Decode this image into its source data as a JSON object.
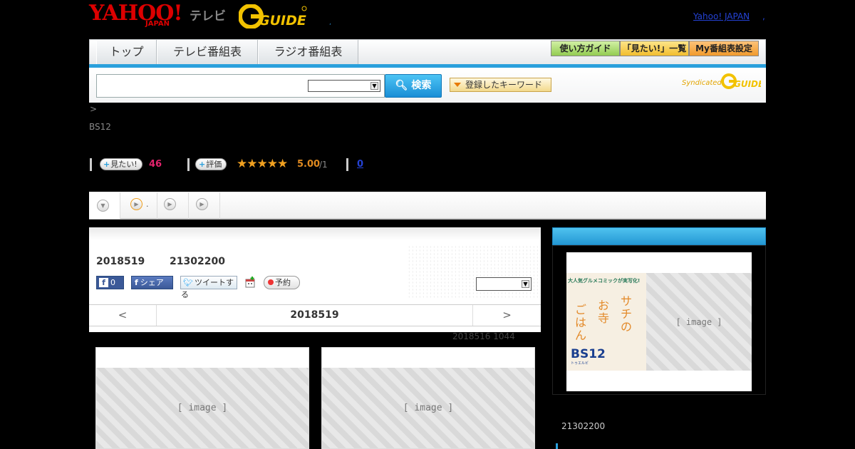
{
  "header": {
    "yahoo": "YAHOO!",
    "yahoo_sub": "JAPAN",
    "tv": "テレビ",
    "gguide_logo_text": "GUIDE",
    "dot": ",",
    "yahoo_japan_link": "Yahoo! JAPAN",
    "yahoo_japan_link_suffix": ","
  },
  "nav": {
    "tabs": [
      {
        "label": "トップ"
      },
      {
        "label": "テレビ番組表"
      },
      {
        "label": "ラジオ番組表"
      }
    ],
    "buttons": [
      {
        "label": "使い方ガイド",
        "color": "#a9d96a"
      },
      {
        "label": "「見たい!」一覧",
        "color": "#f6c93f"
      },
      {
        "label": "My番組表設定",
        "color": "#f6a23a"
      }
    ]
  },
  "search": {
    "placeholder": "",
    "select_value": "",
    "button_label": "検索",
    "keyword_button_label": "登録したキーワード",
    "syndicated": "Syndicated",
    "syndicated_logo": "GUIDE"
  },
  "breadcrumb": ">",
  "channel": "BS12",
  "stats": {
    "mitai_label": "見たい!",
    "mitai_count": "46",
    "hyoka_label": "評価",
    "stars": "★★★★★",
    "rating": "5.00",
    "rating_of": "/1",
    "review_count": "0"
  },
  "tabs": [
    {
      "label": ""
    },
    {
      "label": "."
    },
    {
      "label": ""
    },
    {
      "label": ""
    }
  ],
  "program": {
    "date": "2018519",
    "time": "21302200",
    "fb_like_count": "0",
    "fb_share": "シェア",
    "tweet": "ツイートする",
    "record": "予約",
    "select_value": "",
    "day_prev": "<",
    "day_current": "2018519",
    "day_next": ">",
    "updated": "2018516  1044"
  },
  "sidebar": {
    "ad_tagline": "大人気グルメコミックが実写化!",
    "ad_title_col1": "サチの",
    "ad_title_col2": "お寺",
    "ad_title_col3": "ごはん",
    "ad_channel": "BS12",
    "ad_channel_sub": "トゥエルビ",
    "time": "21302200"
  }
}
